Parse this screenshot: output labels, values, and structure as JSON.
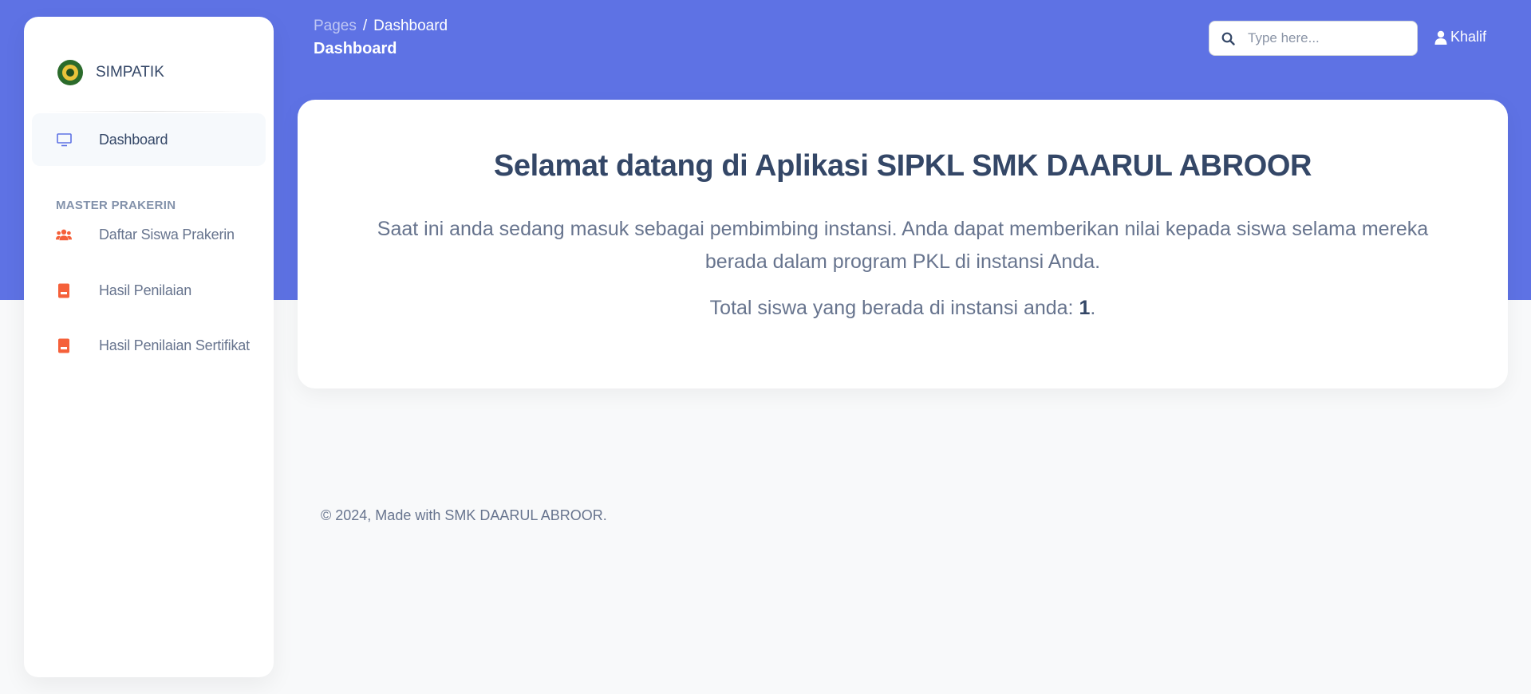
{
  "brand": {
    "name": "SIMPATIK"
  },
  "sidebar": {
    "items": [
      {
        "label": "Dashboard",
        "icon": "monitor-icon"
      },
      {
        "label": "Daftar Siswa Prakerin",
        "icon": "users-icon"
      },
      {
        "label": "Hasil Penilaian",
        "icon": "book-icon"
      },
      {
        "label": "Hasil Penilaian Sertifikat",
        "icon": "book-icon"
      }
    ],
    "section_title": "MASTER PRAKERIN"
  },
  "header": {
    "breadcrumb_root": "Pages",
    "breadcrumb_separator": "/",
    "breadcrumb_current": "Dashboard",
    "page_title": "Dashboard",
    "search_placeholder": "Type here...",
    "user_name": "Khalif"
  },
  "main": {
    "heading": "Selamat datang di Aplikasi SIPKL SMK DAARUL ABROOR",
    "description": "Saat ini anda sedang masuk sebagai pembimbing instansi. Anda dapat memberikan nilai kepada siswa selama mereka berada dalam program PKL di instansi Anda.",
    "total_label": "Total siswa yang berada di instansi anda: ",
    "total_value": "1",
    "total_suffix": "."
  },
  "footer": {
    "text": "© 2024, Made with SMK DAARUL ABROOR."
  },
  "colors": {
    "primary": "#5e72e4",
    "accent": "#f5603a",
    "text_dark": "#344767",
    "text_muted": "#67748e"
  }
}
